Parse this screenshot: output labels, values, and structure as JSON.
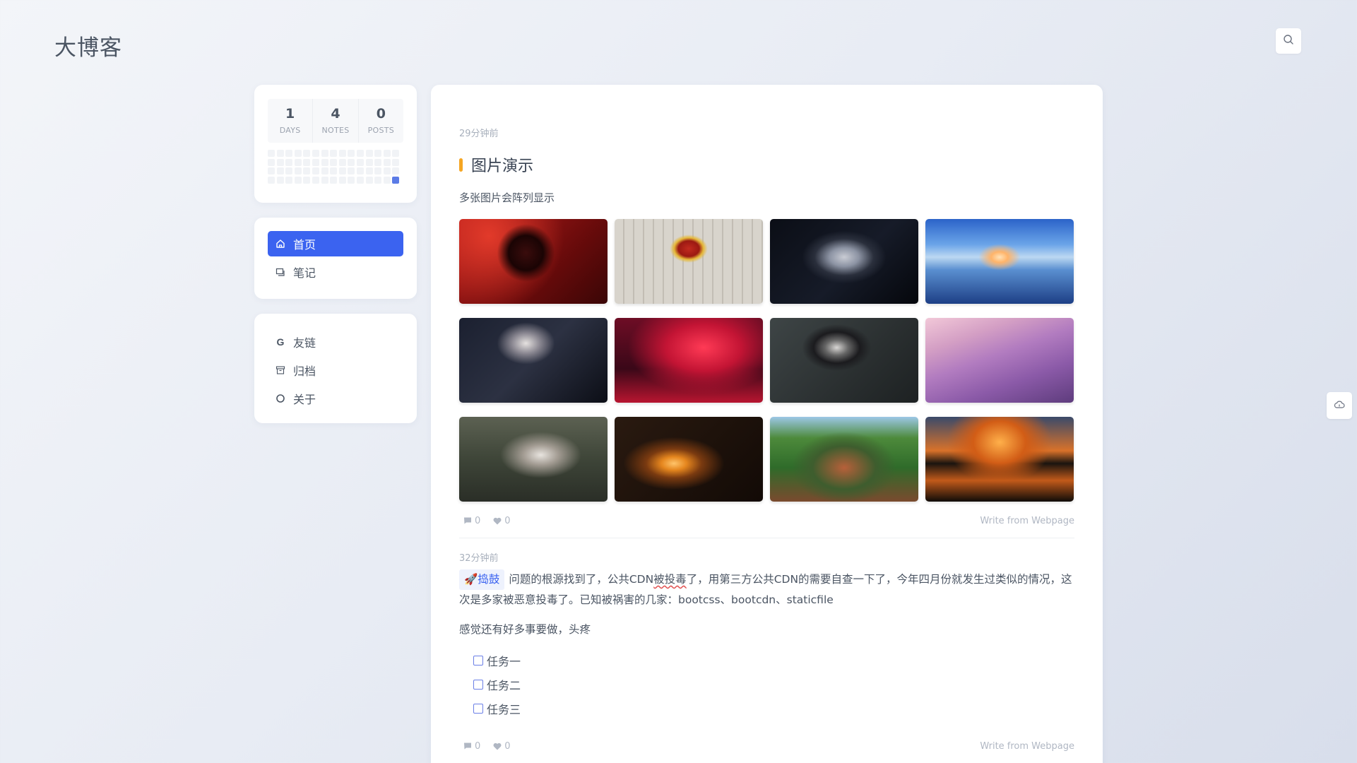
{
  "site": {
    "title": "大博客"
  },
  "stats": [
    {
      "value": "1",
      "label": "DAYS"
    },
    {
      "value": "4",
      "label": "NOTES"
    },
    {
      "value": "0",
      "label": "POSTS"
    }
  ],
  "heatmap": {
    "columns": 15,
    "rows": 4,
    "active_cells": [
      59
    ]
  },
  "nav": {
    "primary": [
      {
        "label": "首页",
        "icon": "home-icon",
        "active": true
      },
      {
        "label": "笔记",
        "icon": "note-icon",
        "active": false
      }
    ],
    "secondary": [
      {
        "label": "友链",
        "icon": "google-icon"
      },
      {
        "label": "归档",
        "icon": "archive-icon"
      },
      {
        "label": "关于",
        "icon": "circle-icon"
      }
    ]
  },
  "posts": [
    {
      "time": "29分钟前",
      "title": "图片演示",
      "description": "多张图片会阵列显示",
      "images": [
        "red-stage-woman",
        "national-emblem-building",
        "dark-portrait-white-hair",
        "sky-pier-sunset",
        "dark-cosplay-portrait",
        "red-forest",
        "anime-girl-dark-hair",
        "purple-desk-room",
        "window-rain-figure",
        "fire-ring-glow",
        "green-shop-street",
        "orange-cloud-lake"
      ],
      "comments": "0",
      "likes": "0",
      "source": "Write from Webpage"
    },
    {
      "time": "32分钟前",
      "tag": "🚀捣鼓",
      "text_before": "问题的根源找到了，公共CDN",
      "text_underlined": "被投毒",
      "text_after": "了，用第三方公共CDN的需要自查一下了，今年四月份就发生过类似的情况，这次是多家被恶意投毒了。已知被祸害的几家：bootcss、bootcdn、staticfile",
      "paragraph2": "感觉还有好多事要做，头疼",
      "tasks": [
        "任务一",
        "任务二",
        "任务三"
      ],
      "comments": "0",
      "likes": "0",
      "source": "Write from Webpage"
    }
  ]
}
